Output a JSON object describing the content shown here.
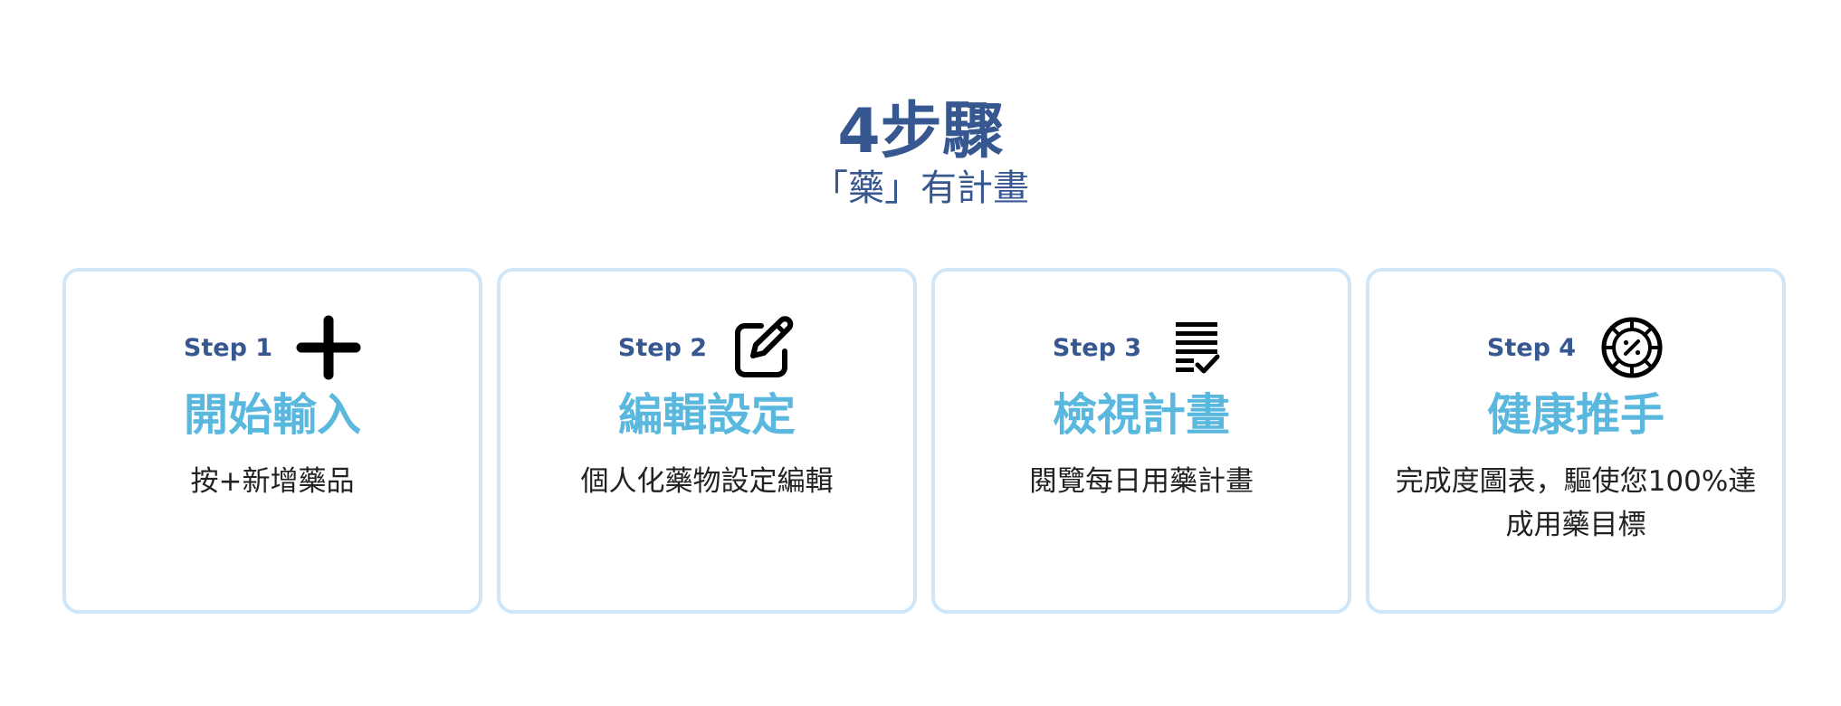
{
  "header": {
    "title": "4步驟",
    "subtitle": "「藥」有計畫"
  },
  "steps": [
    {
      "label": "Step 1",
      "icon": "plus-icon",
      "title": "開始輸入",
      "description": "按+新增藥品"
    },
    {
      "label": "Step 2",
      "icon": "edit-icon",
      "title": "編輯設定",
      "description": "個人化藥物設定編輯"
    },
    {
      "label": "Step 3",
      "icon": "checklist-icon",
      "title": "檢視計畫",
      "description": "閱覽每日用藥計畫"
    },
    {
      "label": "Step 4",
      "icon": "percent-badge-icon",
      "title": "健康推手",
      "description": "完成度圖表，驅使您100%達成用藥目標"
    }
  ],
  "colors": {
    "heading": "#36578f",
    "card_title": "#5ab8de",
    "card_border": "#cfe6f8",
    "body_text": "#222222",
    "icon": "#000000"
  }
}
